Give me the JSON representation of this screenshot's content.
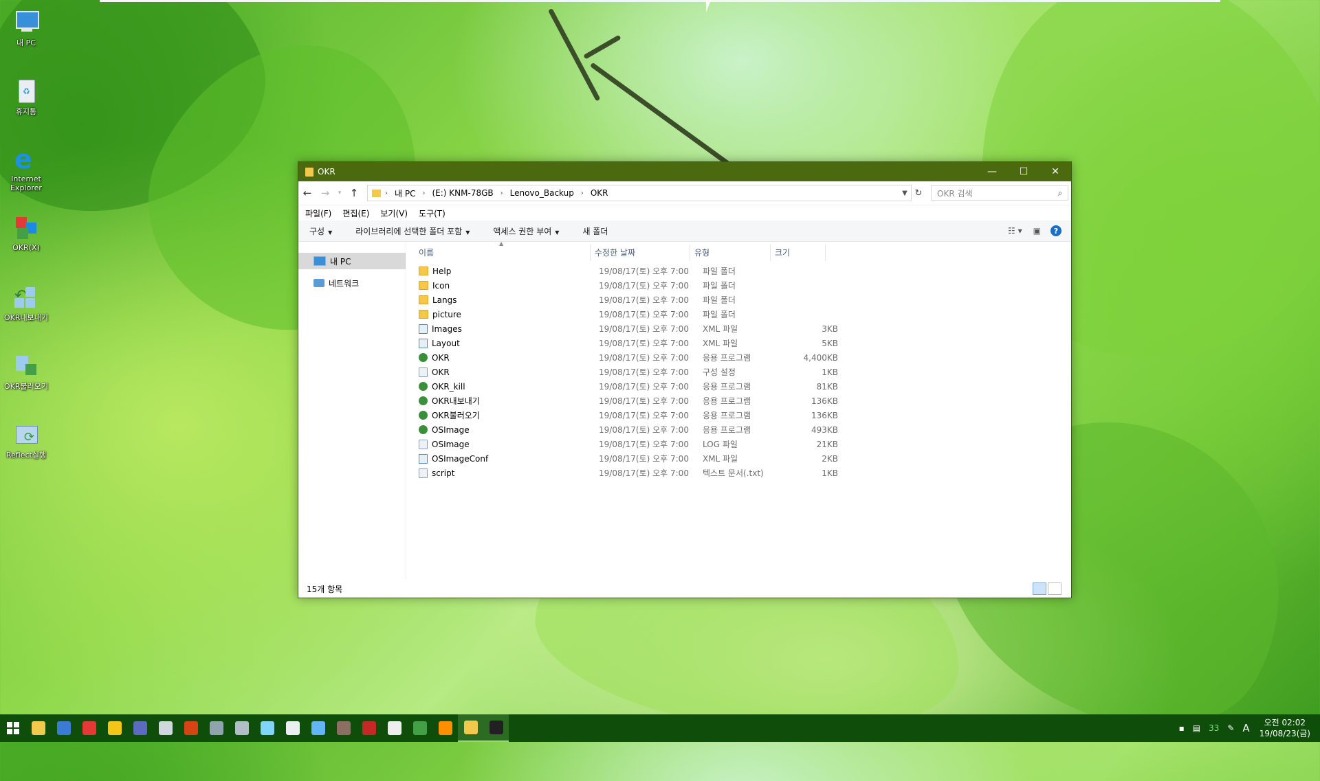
{
  "desktop": {
    "icons": [
      {
        "label": "내 PC",
        "icon": "computer-icon"
      },
      {
        "label": "휴지통",
        "icon": "recycle-bin-icon"
      },
      {
        "label": "Internet Explorer",
        "icon": "internet-explorer-icon"
      },
      {
        "label": "OKR(X)",
        "icon": "okr-app-icon"
      },
      {
        "label": "OKR내보내기",
        "icon": "okr-export-icon"
      },
      {
        "label": "OKR불러오기",
        "icon": "okr-import-icon"
      },
      {
        "label": "Reflect실행",
        "icon": "reflect-icon"
      }
    ]
  },
  "window": {
    "title": "OKR",
    "breadcrumb": [
      "내 PC",
      "(E:) KNM-78GB",
      "Lenovo_Backup",
      "OKR"
    ],
    "search_placeholder": "OKR 검색",
    "menu": [
      "파일(F)",
      "편집(E)",
      "보기(V)",
      "도구(T)"
    ],
    "commands": [
      "구성",
      "라이브러리에 선택한 폴더 포함",
      "액세스 권한 부여",
      "새 폴더"
    ],
    "nav": [
      {
        "label": "내 PC",
        "selected": true
      },
      {
        "label": "네트워크",
        "selected": false
      }
    ],
    "columns": {
      "name": "이름",
      "date": "수정한 날짜",
      "type": "유형",
      "size": "크기"
    },
    "files": [
      {
        "name": "Help",
        "date": "19/08/17(토) 오후 7:00",
        "type": "파일 폴더",
        "size": "",
        "icon": "folder"
      },
      {
        "name": "Icon",
        "date": "19/08/17(토) 오후 7:00",
        "type": "파일 폴더",
        "size": "",
        "icon": "folder"
      },
      {
        "name": "Langs",
        "date": "19/08/17(토) 오후 7:00",
        "type": "파일 폴더",
        "size": "",
        "icon": "folder"
      },
      {
        "name": "picture",
        "date": "19/08/17(토) 오후 7:00",
        "type": "파일 폴더",
        "size": "",
        "icon": "folder"
      },
      {
        "name": "Images",
        "date": "19/08/17(토) 오후 7:00",
        "type": "XML 파일",
        "size": "3KB",
        "icon": "xml"
      },
      {
        "name": "Layout",
        "date": "19/08/17(토) 오후 7:00",
        "type": "XML 파일",
        "size": "5KB",
        "icon": "xml"
      },
      {
        "name": "OKR",
        "date": "19/08/17(토) 오후 7:00",
        "type": "응용 프로그램",
        "size": "4,400KB",
        "icon": "app"
      },
      {
        "name": "OKR",
        "date": "19/08/17(토) 오후 7:00",
        "type": "구성 설정",
        "size": "1KB",
        "icon": "ini"
      },
      {
        "name": "OKR_kill",
        "date": "19/08/17(토) 오후 7:00",
        "type": "응용 프로그램",
        "size": "81KB",
        "icon": "app"
      },
      {
        "name": "OKR내보내기",
        "date": "19/08/17(토) 오후 7:00",
        "type": "응용 프로그램",
        "size": "136KB",
        "icon": "app"
      },
      {
        "name": "OKR불러오기",
        "date": "19/08/17(토) 오후 7:00",
        "type": "응용 프로그램",
        "size": "136KB",
        "icon": "app"
      },
      {
        "name": "OSImage",
        "date": "19/08/17(토) 오후 7:00",
        "type": "응용 프로그램",
        "size": "493KB",
        "icon": "app"
      },
      {
        "name": "OSImage",
        "date": "19/08/17(토) 오후 7:00",
        "type": "LOG 파일",
        "size": "21KB",
        "icon": "ini"
      },
      {
        "name": "OSImageConf",
        "date": "19/08/17(토) 오후 7:00",
        "type": "XML 파일",
        "size": "2KB",
        "icon": "xml"
      },
      {
        "name": "script",
        "date": "19/08/17(토) 오후 7:00",
        "type": "텍스트 문서(.txt)",
        "size": "1KB",
        "icon": "ini"
      }
    ],
    "status": "15개 항목"
  },
  "taskbar": {
    "apps": [
      {
        "name": "file-explorer",
        "color": "#f2c94c"
      },
      {
        "name": "remote-desktop",
        "color": "#3a7bd5"
      },
      {
        "name": "anydesk",
        "color": "#e53935"
      },
      {
        "name": "player",
        "color": "#f5c518"
      },
      {
        "name": "browser",
        "color": "#5c6bc0"
      },
      {
        "name": "tool-a",
        "color": "#cfd8dc"
      },
      {
        "name": "tool-b",
        "color": "#d84315"
      },
      {
        "name": "tool-c",
        "color": "#90a4ae"
      },
      {
        "name": "tool-d",
        "color": "#b0bec5"
      },
      {
        "name": "tool-e",
        "color": "#81d4fa"
      },
      {
        "name": "tool-f",
        "color": "#eceff1"
      },
      {
        "name": "tool-g",
        "color": "#64b5f6"
      },
      {
        "name": "tool-h",
        "color": "#8d6e63"
      },
      {
        "name": "tool-i",
        "color": "#c62828"
      },
      {
        "name": "shield",
        "color": "#eeeeee"
      },
      {
        "name": "sync",
        "color": "#43a047"
      },
      {
        "name": "tool-j",
        "color": "#ff8f00"
      },
      {
        "name": "explorer-open",
        "color": "#f2c94c"
      },
      {
        "name": "terminal",
        "color": "#212121"
      }
    ],
    "tray_text": "33",
    "ime": "A",
    "clock_time": "오전 02:02",
    "clock_date": "19/08/23(금)"
  }
}
